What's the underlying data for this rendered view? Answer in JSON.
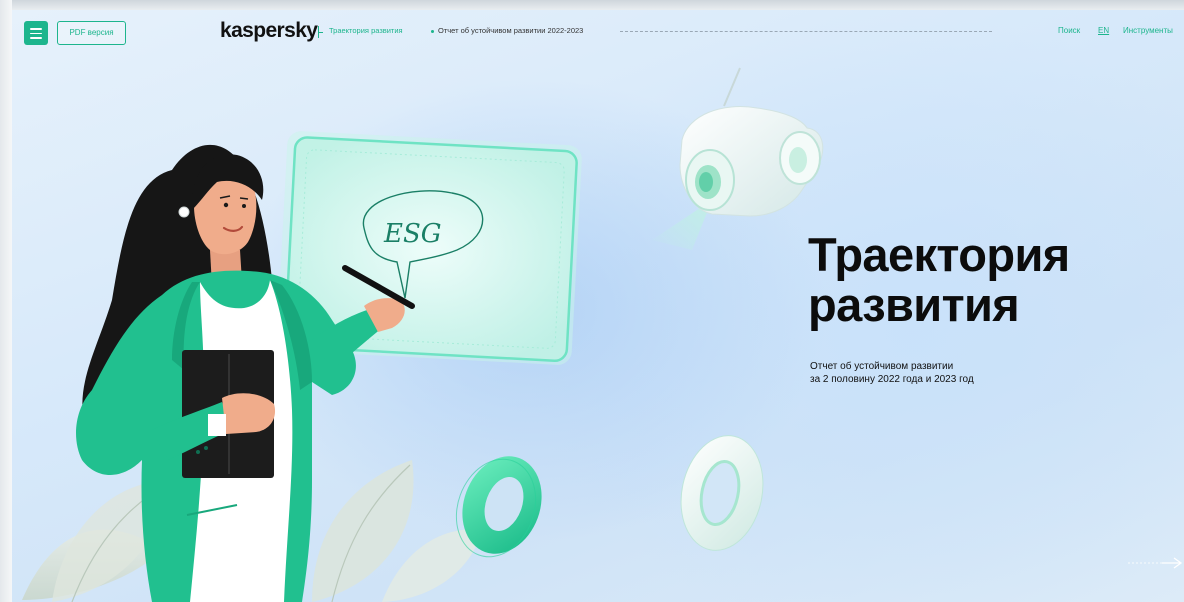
{
  "header": {
    "pdf_label": "PDF версия",
    "logo": "kaspersky",
    "breadcrumb_current": "Траектория развития",
    "breadcrumb_doc": "Отчет об устойчивом развитии 2022-2023",
    "search_label": "Поиск",
    "lang_label": "EN",
    "tools_label": "Инструменты"
  },
  "hero": {
    "title_line1": "Траектория",
    "title_line2": "развития",
    "subtitle_line1": "Отчет об устойчивом развитии",
    "subtitle_line2": "за 2 половину 2022 года и 2023 год",
    "board_text": "ESG"
  },
  "colors": {
    "accent": "#1db58d",
    "title": "#0c0c0c",
    "jacket": "#21c08f",
    "hair": "#161616"
  },
  "icons": {
    "menu": "hamburger-icon",
    "next": "arrow-right-icon"
  }
}
